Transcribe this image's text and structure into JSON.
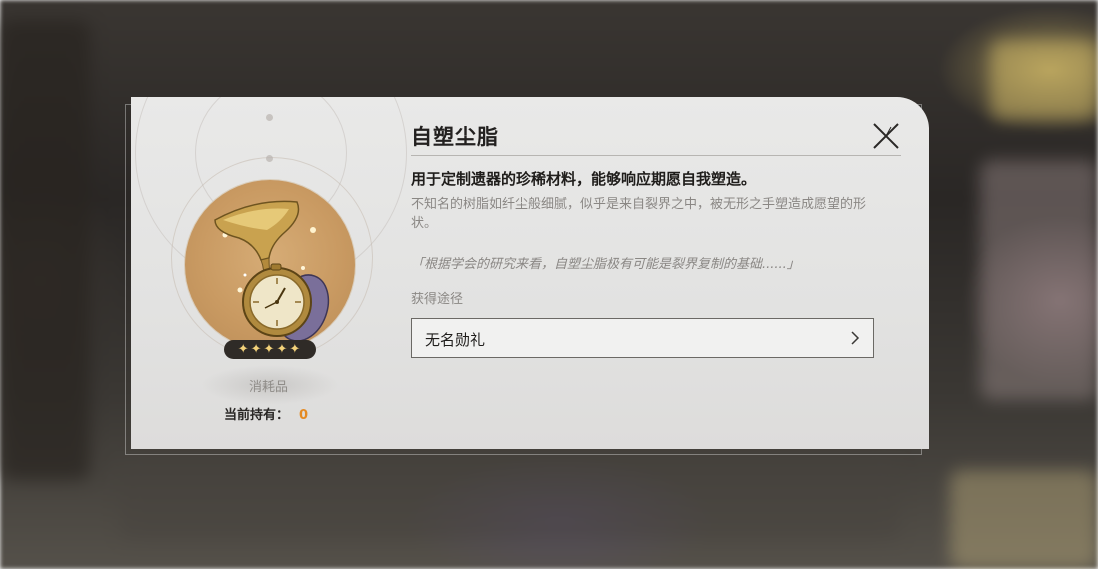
{
  "item": {
    "name": "自塑尘脂",
    "headline": "用于定制遗器的珍稀材料，能够响应期愿自我塑造。",
    "description": "不知名的树脂如纤尘般细腻，似乎是来自裂界之中，被无形之手塑造成愿望的形状。",
    "quote": "「根据学会的研究来看，自塑尘脂极有可能是裂界复制的基础......」",
    "rarity_stars": "✦✦✦✦✦",
    "rarity": 5,
    "category": "消耗品",
    "owned_label": "当前持有：",
    "owned_count": "0"
  },
  "sources": {
    "label": "获得途径",
    "items": [
      {
        "label": "无名勋礼"
      }
    ]
  },
  "icons": {
    "close": "close-icon",
    "chevron": "chevron-right-icon",
    "item_art": "hourglass-pocketwatch-icon"
  },
  "colors": {
    "accent_count": "#e48a22",
    "rarity_star": "#f3d27a",
    "dialog_bg": "#e5e5e4"
  }
}
